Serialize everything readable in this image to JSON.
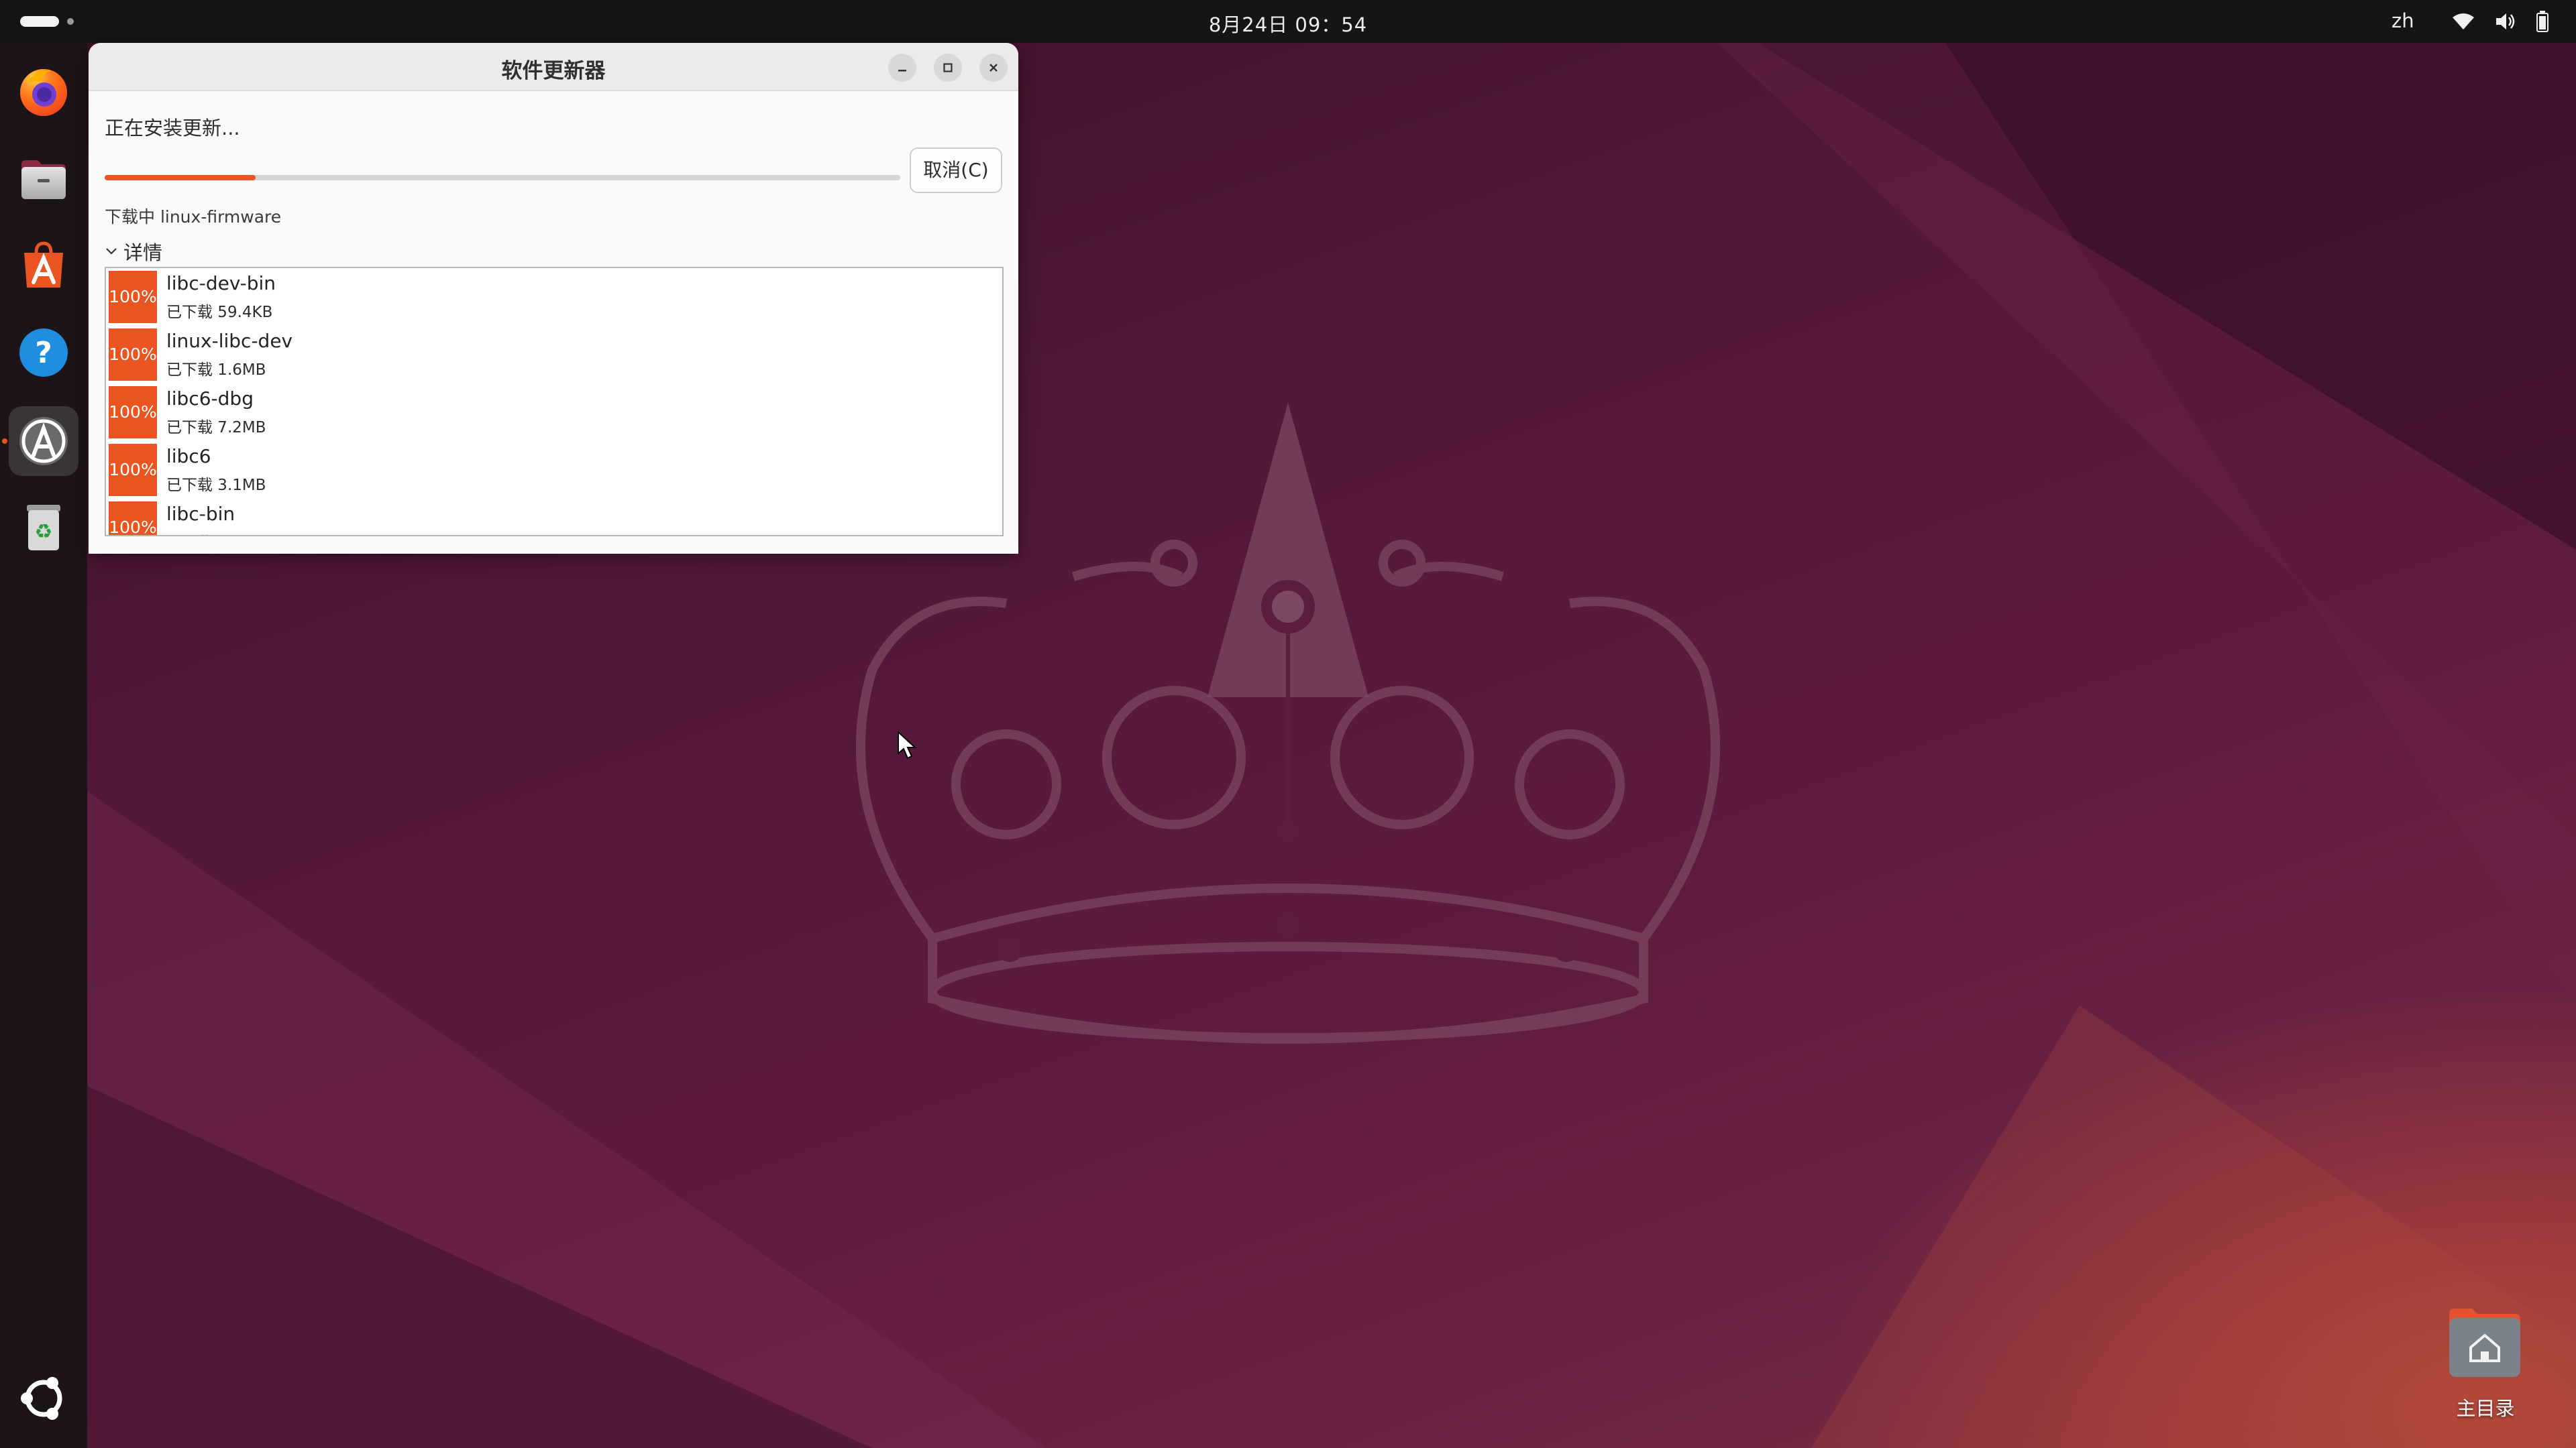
{
  "topbar": {
    "clock": "8月24日  09：54",
    "input_method": "zh"
  },
  "dock": {
    "apps": [
      {
        "name": "Firefox",
        "icon": "firefox-icon"
      },
      {
        "name": "Files",
        "icon": "files-icon"
      },
      {
        "name": "App Center",
        "icon": "app-center-icon"
      },
      {
        "name": "Help",
        "icon": "help-icon"
      },
      {
        "name": "Software Updater",
        "icon": "software-updater-icon",
        "active": true
      },
      {
        "name": "Trash",
        "icon": "trash-icon"
      }
    ],
    "show_apps_icon": "ubuntu-logo-icon"
  },
  "window": {
    "title": "软件更新器",
    "status": "正在安装更新...",
    "progress": 0.19,
    "cancel_label": "取消(C)",
    "downloading": "下载中 linux-firmware",
    "details_label": "详情",
    "packages": [
      {
        "percent": "100%",
        "name": "libc-dev-bin",
        "downloaded": "已下载 59.4KB"
      },
      {
        "percent": "100%",
        "name": "linux-libc-dev",
        "downloaded": "已下载 1.6MB"
      },
      {
        "percent": "100%",
        "name": "libc6-dbg",
        "downloaded": "已下载 7.2MB"
      },
      {
        "percent": "100%",
        "name": "libc6",
        "downloaded": "已下载 3.1MB"
      },
      {
        "percent": "100%",
        "name": "libc-bin",
        "downloaded": "已下载 ..."
      }
    ]
  },
  "desktop": {
    "home_label": "主目录"
  },
  "colors": {
    "accent": "#e95420",
    "topbar": "#151515",
    "dock": "#1d1418"
  }
}
